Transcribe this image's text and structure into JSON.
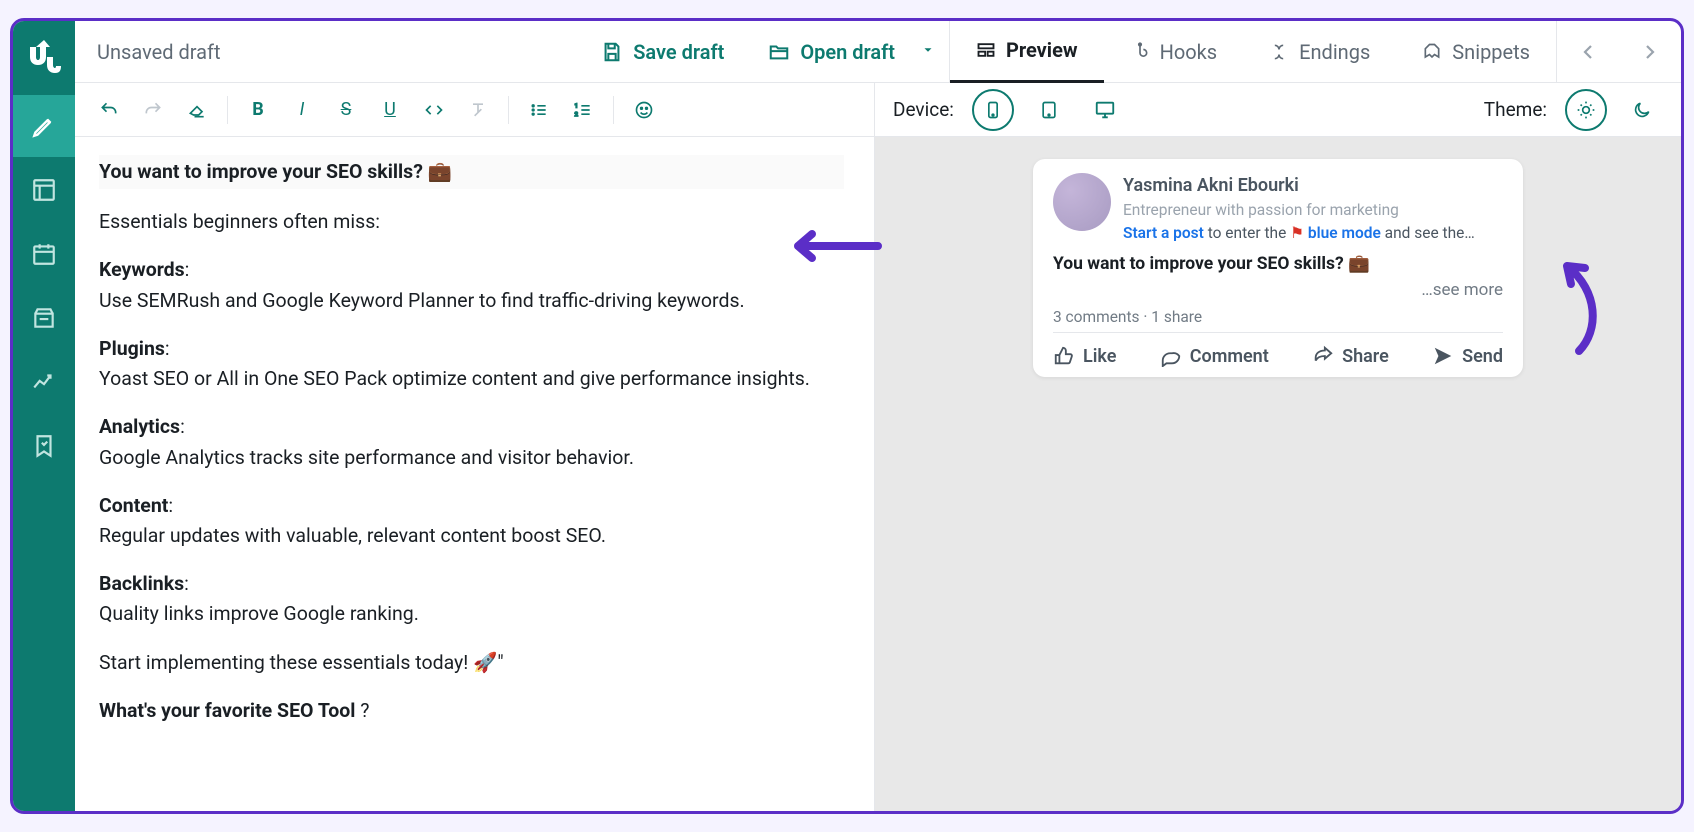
{
  "header": {
    "draft_title": "Unsaved draft",
    "save_label": "Save draft",
    "open_label": "Open draft"
  },
  "tabs": {
    "preview": "Preview",
    "hooks": "Hooks",
    "endings": "Endings",
    "snippets": "Snippets"
  },
  "previewbar": {
    "device_label": "Device:",
    "theme_label": "Theme:"
  },
  "editor": {
    "line1_bold": "You want to improve your SEO skills? 💼",
    "line2": "Essentials beginners often miss:",
    "sections": [
      {
        "title": "Keywords",
        "body": "Use SEMRush and Google Keyword Planner to find traffic-driving keywords."
      },
      {
        "title": "Plugins",
        "body": "Yoast SEO or All in One SEO Pack optimize content and give performance insights."
      },
      {
        "title": "Analytics",
        "body": "Google Analytics tracks site performance and visitor behavior."
      },
      {
        "title": "Content",
        "body": "Regular updates with valuable, relevant content boost SEO."
      },
      {
        "title": "Backlinks",
        "body": "Quality links improve Google ranking."
      }
    ],
    "line3": "Start implementing these essentials today! 🚀\"",
    "line4_bold": "What's your favorite SEO Tool",
    "line4_rest": " ?"
  },
  "post": {
    "name": "Yasmina Akni Ebourki",
    "tagline": "Entrepreneur with passion for marketing",
    "hint_pre": "Start a post",
    "hint_mid": " to enter the ",
    "hint_blue2": "blue mode",
    "hint_post": " and see the…",
    "body": "You want to improve your SEO skills? 💼",
    "seemore": "…see more",
    "stats": "3 comments · 1 share",
    "actions": {
      "like": "Like",
      "comment": "Comment",
      "share": "Share",
      "send": "Send"
    }
  }
}
